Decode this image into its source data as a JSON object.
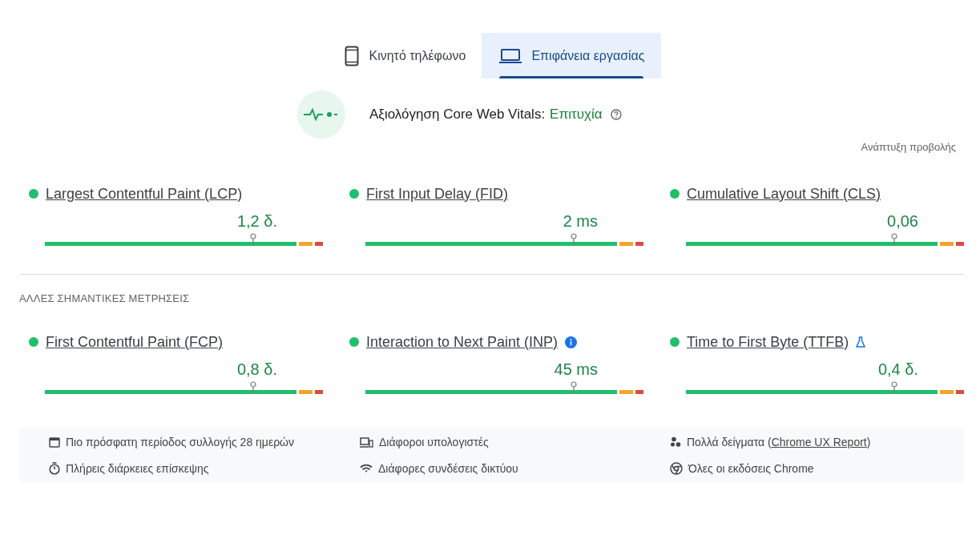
{
  "tabs": [
    {
      "label": "Κινητό τηλέφωνο",
      "kind": "phone",
      "selected": false
    },
    {
      "label": "Επιφάνεια εργασίας",
      "kind": "laptop",
      "selected": true
    }
  ],
  "assessment": {
    "label": "Αξιολόγηση Core Web Vitals:",
    "result": "Επιτυχία",
    "passed": true
  },
  "expand_link": "Ανάπτυξη προβολής",
  "core_metrics": [
    {
      "name": "Largest Contentful Paint (LCP)",
      "value": "1,2 δ.",
      "segments": [
        {
          "kind": "good"
        },
        {
          "kind": "average"
        },
        {
          "kind": "poor"
        }
      ]
    },
    {
      "name": "First Input Delay (FID)",
      "value": "2 ms",
      "segments": [
        {
          "kind": "good"
        },
        {
          "kind": "average"
        },
        {
          "kind": "poor"
        }
      ]
    },
    {
      "name": "Cumulative Layout Shift (CLS)",
      "value": "0,06",
      "segments": [
        {
          "kind": "good"
        },
        {
          "kind": "average"
        },
        {
          "kind": "poor"
        }
      ]
    }
  ],
  "other_title": "ΑΛΛΕΣ ΣΗΜΑΝΤΙΚΕΣ ΜΕΤΡΗΣΕΙΣ",
  "other_metrics": [
    {
      "name": "First Contentful Paint (FCP)",
      "value": "0,8 δ.",
      "segments": [
        {
          "kind": "good"
        },
        {
          "kind": "average"
        },
        {
          "kind": "poor"
        }
      ]
    },
    {
      "name": "Interaction to Next Paint (INP)",
      "value": "45 ms",
      "kind": "info",
      "segments": [
        {
          "kind": "good"
        },
        {
          "kind": "average"
        },
        {
          "kind": "poor"
        }
      ]
    },
    {
      "name": "Time to First Byte (TTFB)",
      "value": "0,4 δ.",
      "kind": "lab",
      "segments": [
        {
          "kind": "good"
        },
        {
          "kind": "average"
        },
        {
          "kind": "poor"
        }
      ]
    }
  ],
  "footer": [
    {
      "kind": "calendar",
      "text": "Πιο πρόσφατη περίοδος συλλογής 28 ημερών"
    },
    {
      "kind": "devices",
      "text": "Διάφοροι υπολογιστές"
    },
    {
      "kind": "samples",
      "text": "Πολλά δείγματα (",
      "link": "Chrome UX Report",
      "suffix": ")"
    },
    {
      "kind": "timer",
      "text": "Πλήρεις διάρκειες επίσκεψης"
    },
    {
      "kind": "network",
      "text": "Διάφορες συνδέσεις δικτύου"
    },
    {
      "kind": "chrome",
      "text": "Όλες οι εκδόσεις Chrome"
    }
  ]
}
